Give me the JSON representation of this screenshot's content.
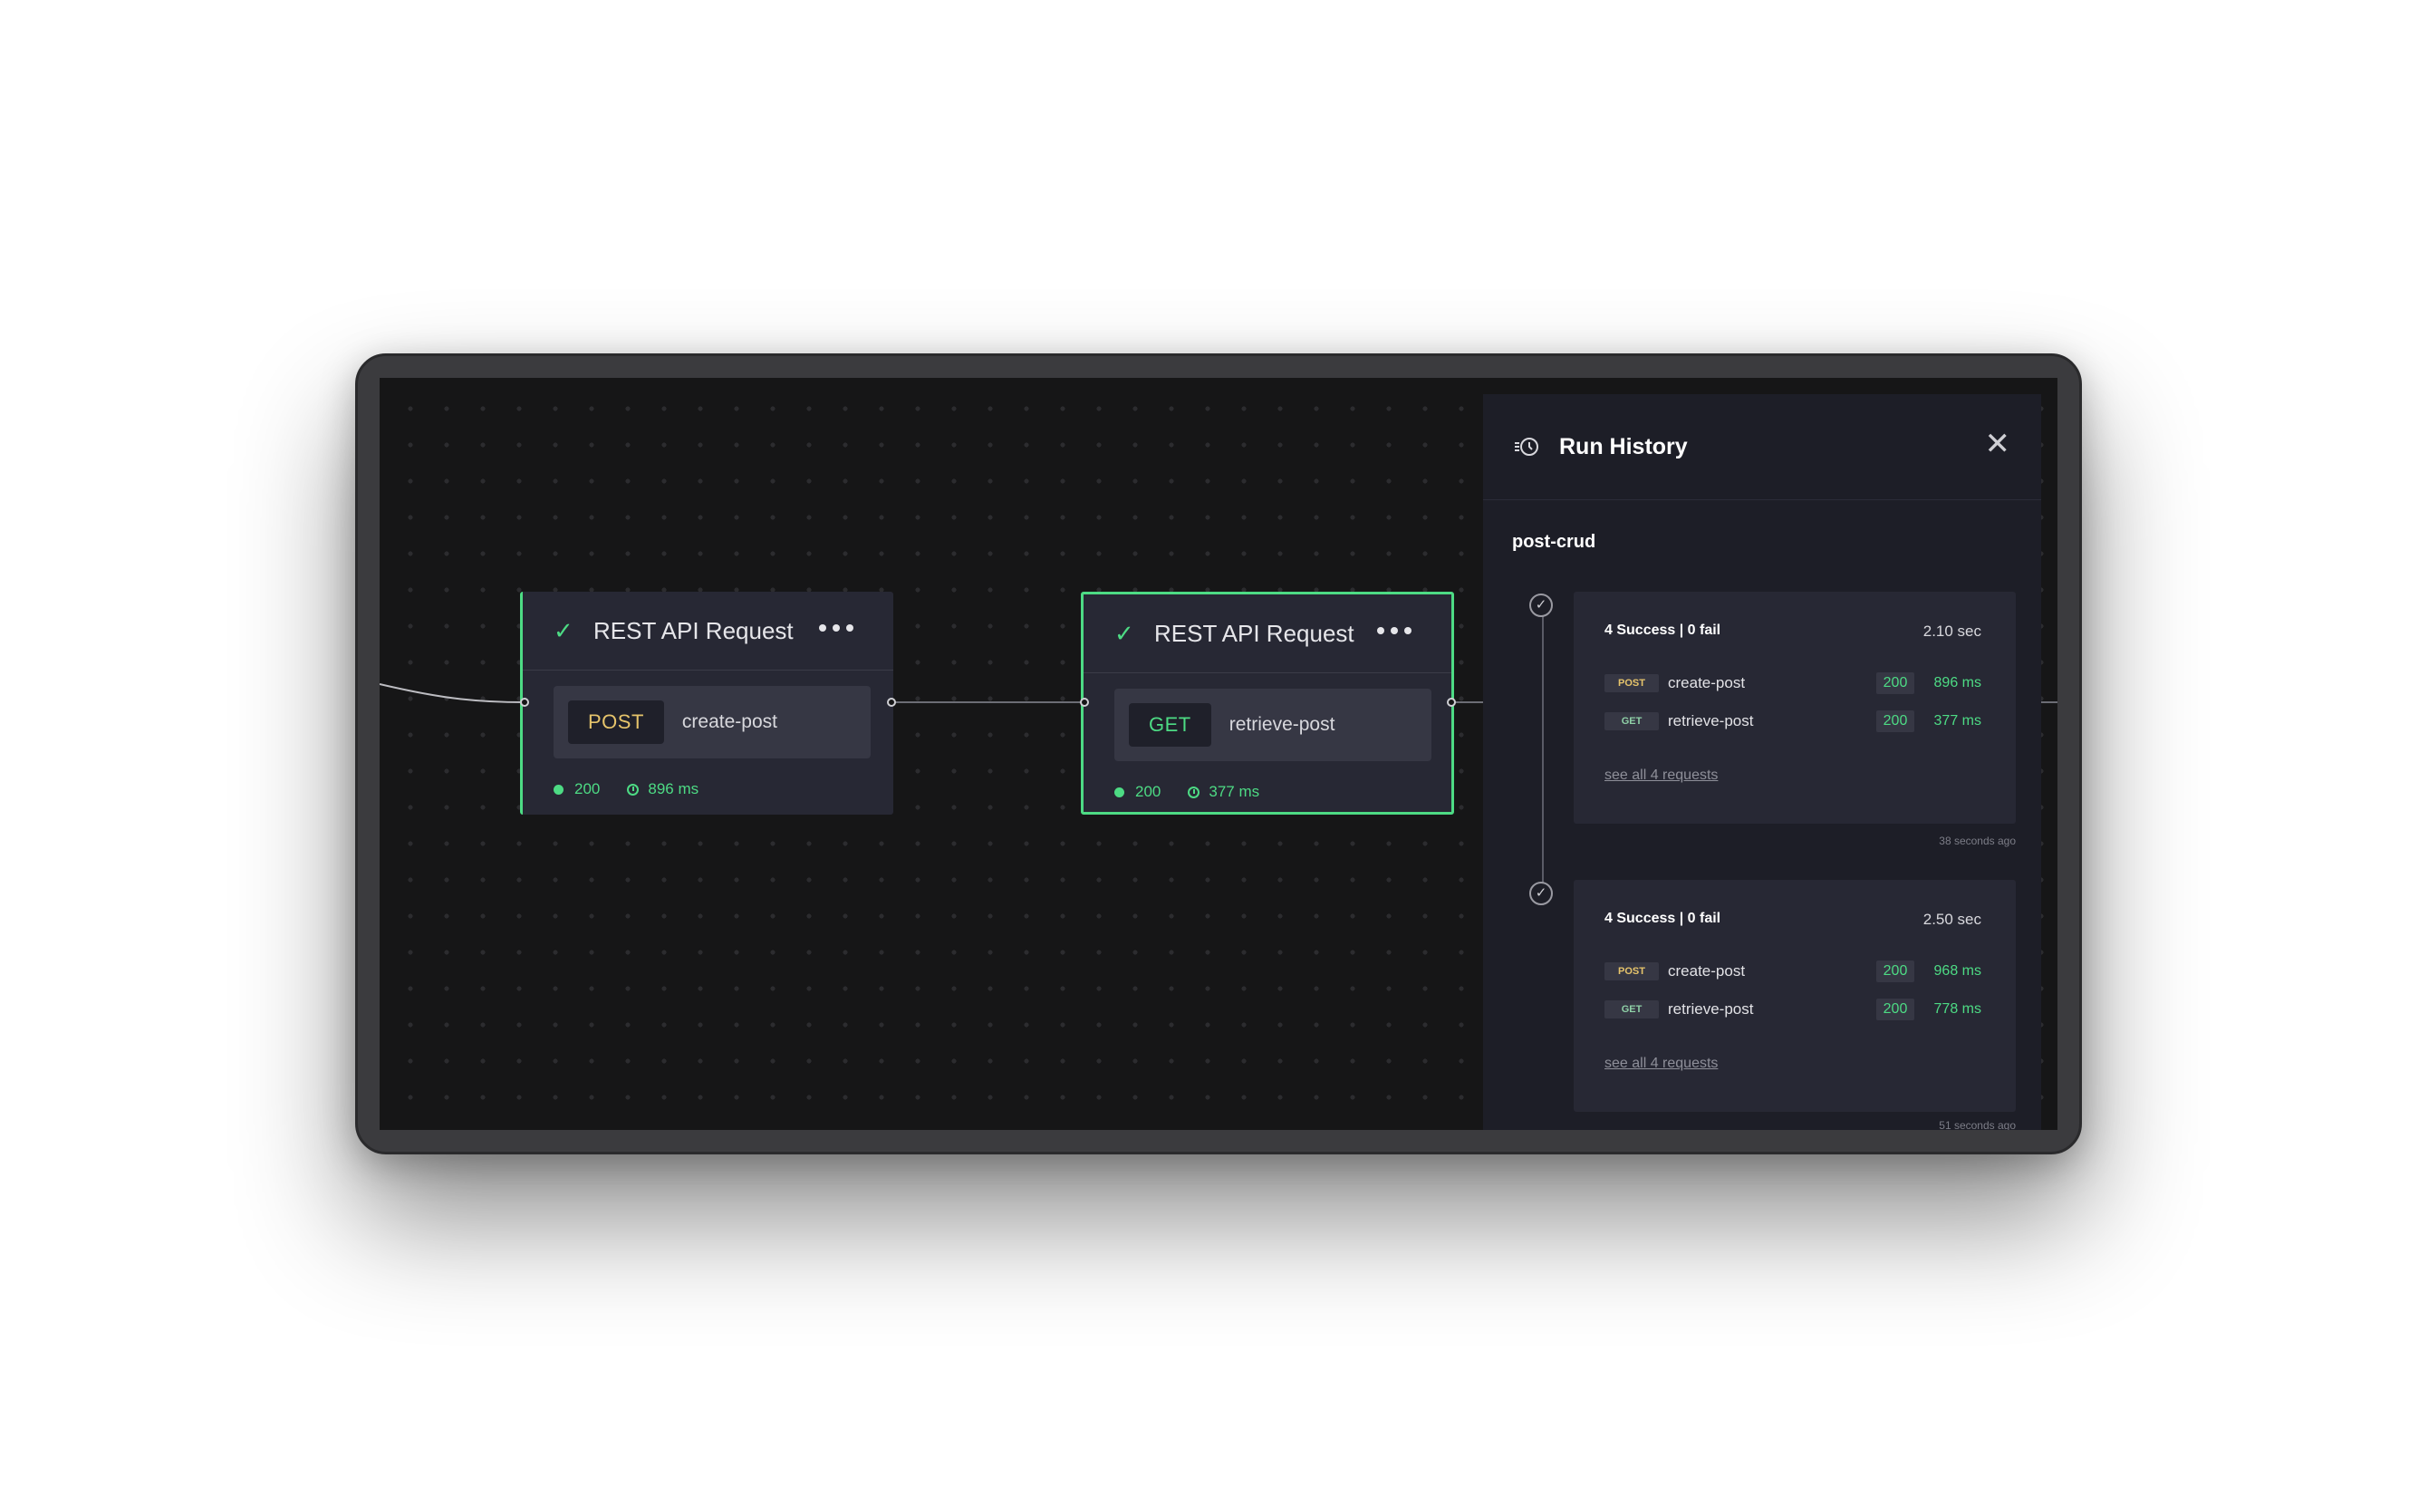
{
  "canvas": {
    "nodes": [
      {
        "title": "REST API Request",
        "method": "POST",
        "name": "create-post",
        "status": "200",
        "time": "896 ms"
      },
      {
        "title": "REST API Request",
        "method": "GET",
        "name": "retrieve-post",
        "status": "200",
        "time": "377 ms"
      }
    ]
  },
  "panel": {
    "title": "Run History",
    "flow_name": "post-crud",
    "runs": [
      {
        "summary": "4 Success | 0 fail",
        "duration": "2.10 sec",
        "requests": [
          {
            "method": "POST",
            "name": "create-post",
            "status": "200",
            "time": "896 ms"
          },
          {
            "method": "GET",
            "name": "retrieve-post",
            "status": "200",
            "time": "377 ms"
          }
        ],
        "see_all": "see all 4 requests",
        "ago": "38 seconds ago"
      },
      {
        "summary": "4 Success | 0 fail",
        "duration": "2.50 sec",
        "requests": [
          {
            "method": "POST",
            "name": "create-post",
            "status": "200",
            "time": "968 ms"
          },
          {
            "method": "GET",
            "name": "retrieve-post",
            "status": "200",
            "time": "778 ms"
          }
        ],
        "see_all": "see all 4 requests",
        "ago": "51 seconds ago"
      }
    ]
  },
  "colors": {
    "accent": "#4ddb84",
    "post": "#e6c46b",
    "background": "#161617",
    "panel": "#1d1e27",
    "card": "#272834"
  },
  "icons": [
    "check-icon",
    "more-dots-icon",
    "history-icon",
    "close-icon",
    "clock-icon",
    "status-dot-icon"
  ]
}
